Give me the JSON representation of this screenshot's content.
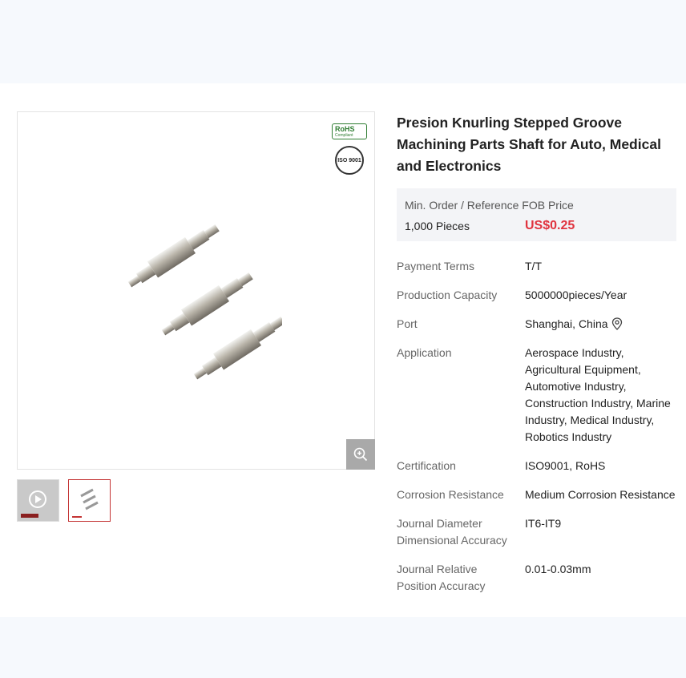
{
  "product": {
    "title": "Presion Knurling Stepped Groove Machining Parts Shaft for Auto, Medical and Electronics"
  },
  "badges": {
    "rohs": "RoHS",
    "rohs_sub": "Compliant",
    "iso": "ISO 9001"
  },
  "price": {
    "header": "Min. Order / Reference FOB Price",
    "moq": "1,000 Pieces",
    "value": "US$0.25"
  },
  "attributes": [
    {
      "key": "Payment Terms",
      "value": "T/T"
    },
    {
      "key": "Production Capacity",
      "value": "5000000pieces/Year"
    },
    {
      "key": "Port",
      "value": "Shanghai, China"
    },
    {
      "key": "Application",
      "value": "Aerospace Industry, Agricultural Equipment, Automotive Industry, Construction Industry, Marine Industry, Medical Industry, Robotics Industry"
    },
    {
      "key": "Certification",
      "value": "ISO9001, RoHS"
    },
    {
      "key": "Corrosion Resistance",
      "value": "Medium Corrosion Resistance"
    },
    {
      "key": "Journal Diameter Dimensional Accuracy",
      "value": "IT6-IT9"
    },
    {
      "key": "Journal Relative Position Accuracy",
      "value": "0.01-0.03mm"
    }
  ],
  "colors": {
    "price": "#e0343f",
    "thumb_active_border": "#c43434",
    "page_bg": "#f6f9fd"
  },
  "icons": [
    "zoom-in-icon",
    "location-pin-icon",
    "play-icon"
  ]
}
